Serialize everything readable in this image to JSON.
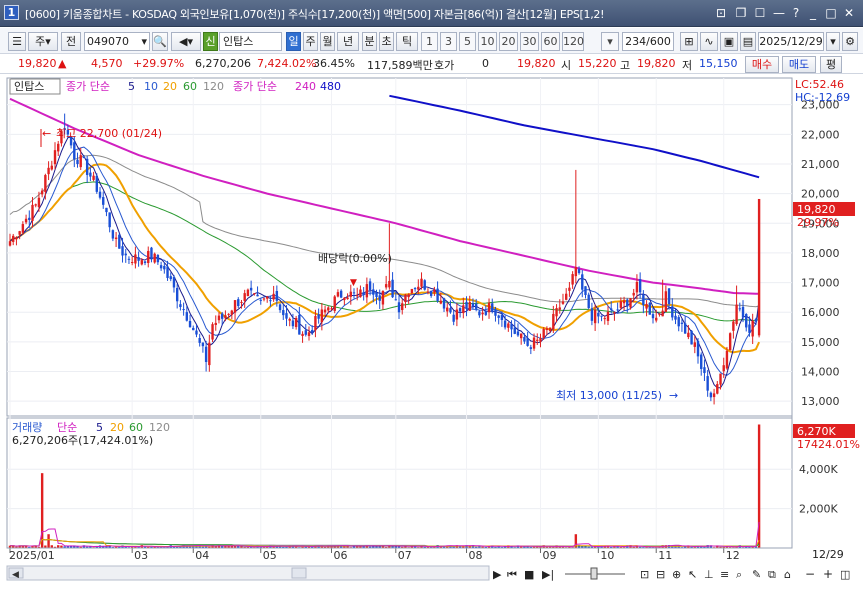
{
  "window": {
    "title": "[0600] 키움종합차트 - KOSDAQ 외국인보유[1,070(천)] 주식수[17,200(천)] 액면[500] 자본금[86(억)] 결산[12월] EPS[1,2!"
  },
  "toolbar": {
    "code": "049070",
    "stock_name": "인탑스",
    "side1": "주",
    "side2": "전",
    "sin_label": "신",
    "periods": [
      "일",
      "주",
      "월",
      "년",
      "분",
      "초",
      "틱"
    ],
    "numbers": [
      "1",
      "3",
      "5",
      "10",
      "20",
      "30",
      "60",
      "120"
    ],
    "count": "234",
    "count_total": "/600",
    "date": "2025/12/29"
  },
  "info": {
    "price": "19,820",
    "arrow": "▲",
    "change": "4,570",
    "change_pct": "+29.97%",
    "volume": "6,270,206",
    "vol_ratio": "7,424.02%",
    "turnover": "36.45%",
    "amount": "117,589백만",
    "hoga_label": "호가",
    "hoga_value": "0",
    "hoga_price": "19,820",
    "open_label": "시",
    "open": "15,220",
    "high_label": "고",
    "high": "19,820",
    "low_label": "저",
    "low": "15,150",
    "buy": "매수",
    "sell": "매도",
    "eval": "평"
  },
  "legend": {
    "name": "인탑스",
    "price_ma_label": "종가 단순",
    "price_ma": [
      "5",
      "10",
      "20",
      "60",
      "120"
    ],
    "price_ma2_label": "종가 단순",
    "price_ma2": [
      "240",
      "480"
    ],
    "volume_label": "거래량",
    "volume_ma_label": "단순",
    "volume_ma": [
      "5",
      "20",
      "60",
      "120"
    ],
    "volume_value": "6,270,206주(17,424.01%)"
  },
  "side_labels": {
    "lc": "LC:52.46",
    "hc": "HC:-12.69",
    "price_tag": "19,820",
    "pct_tag": "29.97%",
    "vol_tag": "6,270K",
    "vol_pct_tag": "17424.01%"
  },
  "annotations": {
    "high": "최고 22,700 (01/24)",
    "low": "최저 13,000 (11/25)",
    "dividend": "배당락(0.00%)"
  },
  "footer": {
    "end_date": "12/29"
  },
  "colors": {
    "up": "#e02020",
    "down": "#1a4fd6",
    "ma5": "#1a1a8c",
    "ma10": "#2a5ad0",
    "ma20": "#f0a000",
    "ma60": "#2a9a30",
    "ma120": "#8c8c8c",
    "ma240": "#d020c0",
    "ma480": "#1010c8"
  },
  "chart_data": {
    "type": "candlestick",
    "price_axis": {
      "ticks": [
        13000,
        14000,
        15000,
        16000,
        17000,
        18000,
        19000,
        20000,
        21000,
        22000,
        23000
      ],
      "range": [
        12500,
        23900
      ]
    },
    "volume_axis": {
      "ticks": [
        "2,000K",
        "4,000K"
      ],
      "values": [
        2000000,
        4000000
      ],
      "range": [
        0,
        6600000
      ]
    },
    "x_ticks": [
      "2025/01",
      "03",
      "04",
      "05",
      "06",
      "07",
      "08",
      "09",
      "10",
      "11",
      "12"
    ],
    "anchors": [
      {
        "d": 0,
        "c": 18400
      },
      {
        "d": 4,
        "c": 19000
      },
      {
        "d": 8,
        "c": 19600
      },
      {
        "d": 12,
        "c": 20800
      },
      {
        "d": 15,
        "c": 21800
      },
      {
        "d": 17,
        "c": 22300
      },
      {
        "d": 20,
        "c": 21300
      },
      {
        "d": 23,
        "c": 21000
      },
      {
        "d": 27,
        "c": 20200
      },
      {
        "d": 30,
        "c": 19300
      },
      {
        "d": 33,
        "c": 18300
      },
      {
        "d": 36,
        "c": 17900
      },
      {
        "d": 40,
        "c": 17800
      },
      {
        "d": 44,
        "c": 17900
      },
      {
        "d": 47,
        "c": 17600
      },
      {
        "d": 50,
        "c": 17000
      },
      {
        "d": 53,
        "c": 16300
      },
      {
        "d": 56,
        "c": 15700
      },
      {
        "d": 59,
        "c": 14900
      },
      {
        "d": 61,
        "c": 14400
      },
      {
        "d": 63,
        "c": 15600
      },
      {
        "d": 66,
        "c": 15800
      },
      {
        "d": 70,
        "c": 16300
      },
      {
        "d": 74,
        "c": 16600
      },
      {
        "d": 78,
        "c": 16300
      },
      {
        "d": 82,
        "c": 16700
      },
      {
        "d": 86,
        "c": 15700
      },
      {
        "d": 89,
        "c": 15600
      },
      {
        "d": 92,
        "c": 15200
      },
      {
        "d": 96,
        "c": 15800
      },
      {
        "d": 100,
        "c": 16300
      },
      {
        "d": 104,
        "c": 16700
      },
      {
        "d": 108,
        "c": 16500
      },
      {
        "d": 112,
        "c": 16900
      },
      {
        "d": 115,
        "c": 16600
      },
      {
        "d": 118,
        "c": 16900
      },
      {
        "d": 121,
        "c": 16200
      },
      {
        "d": 124,
        "c": 16800
      },
      {
        "d": 128,
        "c": 17000
      },
      {
        "d": 132,
        "c": 16700
      },
      {
        "d": 135,
        "c": 16300
      },
      {
        "d": 138,
        "c": 15900
      },
      {
        "d": 142,
        "c": 16200
      },
      {
        "d": 146,
        "c": 16000
      },
      {
        "d": 150,
        "c": 16200
      },
      {
        "d": 154,
        "c": 15700
      },
      {
        "d": 158,
        "c": 15200
      },
      {
        "d": 161,
        "c": 14900
      },
      {
        "d": 164,
        "c": 15000
      },
      {
        "d": 168,
        "c": 15500
      },
      {
        "d": 171,
        "c": 16200
      },
      {
        "d": 174,
        "c": 16700
      },
      {
        "d": 176,
        "c": 17500
      },
      {
        "d": 178,
        "c": 16700
      },
      {
        "d": 181,
        "c": 15900
      },
      {
        "d": 184,
        "c": 15800
      },
      {
        "d": 188,
        "c": 16000
      },
      {
        "d": 192,
        "c": 16400
      },
      {
        "d": 195,
        "c": 16800
      },
      {
        "d": 198,
        "c": 16200
      },
      {
        "d": 201,
        "c": 15800
      },
      {
        "d": 204,
        "c": 16500
      },
      {
        "d": 207,
        "c": 15800
      },
      {
        "d": 210,
        "c": 15400
      },
      {
        "d": 213,
        "c": 14800
      },
      {
        "d": 216,
        "c": 13800
      },
      {
        "d": 218,
        "c": 13200
      },
      {
        "d": 220,
        "c": 13400
      },
      {
        "d": 222,
        "c": 14400
      },
      {
        "d": 224,
        "c": 15300
      },
      {
        "d": 226,
        "c": 16300
      },
      {
        "d": 228,
        "c": 15900
      },
      {
        "d": 230,
        "c": 15500
      },
      {
        "d": 232,
        "c": 15700
      },
      {
        "d": 233,
        "c": 19820
      }
    ],
    "spikes": [
      {
        "d": 17,
        "h": 22700
      },
      {
        "d": 61,
        "l": 14000
      },
      {
        "d": 118,
        "h": 19000
      },
      {
        "d": 176,
        "h": 20800
      },
      {
        "d": 203,
        "h": 17100
      },
      {
        "d": 218,
        "l": 13000
      },
      {
        "d": 226,
        "h": 16900
      },
      {
        "d": 233,
        "h": 19820,
        "l": 15150
      }
    ],
    "volume_spikes": [
      {
        "d": 10,
        "v": 3800000
      },
      {
        "d": 12,
        "v": 700000
      },
      {
        "d": 176,
        "v": 700000
      },
      {
        "d": 233,
        "v": 6270206
      }
    ],
    "ma240_curve": [
      {
        "d": 0,
        "v": 23200
      },
      {
        "d": 20,
        "v": 22200
      },
      {
        "d": 40,
        "v": 21300
      },
      {
        "d": 60,
        "v": 20600
      },
      {
        "d": 80,
        "v": 20000
      },
      {
        "d": 100,
        "v": 19500
      },
      {
        "d": 120,
        "v": 19000
      },
      {
        "d": 140,
        "v": 18400
      },
      {
        "d": 160,
        "v": 17900
      },
      {
        "d": 180,
        "v": 17400
      },
      {
        "d": 200,
        "v": 17000
      },
      {
        "d": 215,
        "v": 16800
      },
      {
        "d": 225,
        "v": 16650
      },
      {
        "d": 233,
        "v": 16620
      }
    ],
    "ma480_curve": [
      {
        "d": 118,
        "v": 23300
      },
      {
        "d": 140,
        "v": 22800
      },
      {
        "d": 160,
        "v": 22300
      },
      {
        "d": 180,
        "v": 21900
      },
      {
        "d": 200,
        "v": 21500
      },
      {
        "d": 215,
        "v": 21100
      },
      {
        "d": 233,
        "v": 20550
      }
    ]
  }
}
